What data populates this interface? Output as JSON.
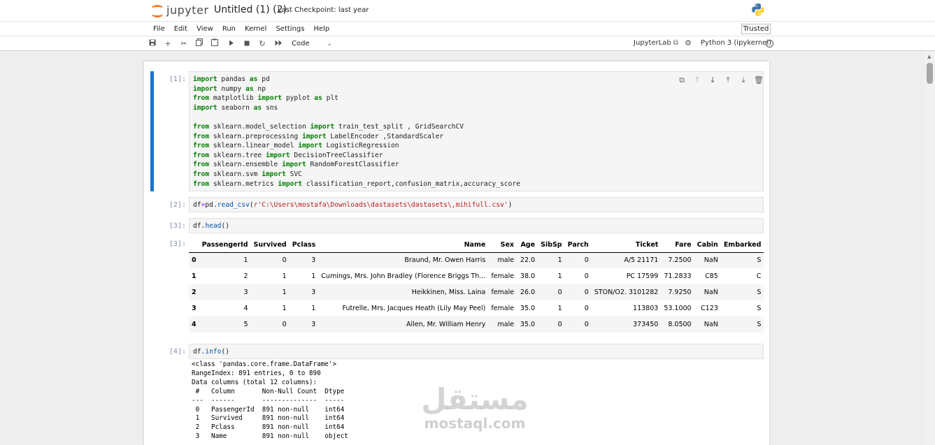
{
  "header": {
    "logo_text": "jupyter",
    "notebook_name": "Untitled (1) (2)",
    "checkpoint": "Last Checkpoint: last year"
  },
  "menu": [
    "File",
    "Edit",
    "View",
    "Run",
    "Kernel",
    "Settings",
    "Help"
  ],
  "trusted_label": "Trusted",
  "toolbar": {
    "cell_type": "Code",
    "jupyterlab_label": "JupyterLab",
    "kernel_name": "Python 3 (ipykernel)"
  },
  "cells": {
    "c1": {
      "prompt": "[1]:",
      "lines": [
        [
          [
            "kw",
            "import"
          ],
          [
            "t",
            " pandas "
          ],
          [
            "kw",
            "as"
          ],
          [
            "t",
            " pd"
          ]
        ],
        [
          [
            "kw",
            "import"
          ],
          [
            "t",
            " numpy "
          ],
          [
            "kw",
            "as"
          ],
          [
            "t",
            " np"
          ]
        ],
        [
          [
            "kw",
            "from"
          ],
          [
            "t",
            " matplotlib "
          ],
          [
            "kw",
            "import"
          ],
          [
            "t",
            " pyplot "
          ],
          [
            "kw",
            "as"
          ],
          [
            "t",
            " plt"
          ]
        ],
        [
          [
            "kw",
            "import"
          ],
          [
            "t",
            " seaborn "
          ],
          [
            "kw",
            "as"
          ],
          [
            "t",
            " sns"
          ]
        ],
        [
          [
            "t",
            ""
          ]
        ],
        [
          [
            "kw",
            "from"
          ],
          [
            "t",
            " sklearn.model_selection "
          ],
          [
            "kw",
            "import"
          ],
          [
            "t",
            " train_test_split , GridSearchCV"
          ]
        ],
        [
          [
            "kw",
            "from"
          ],
          [
            "t",
            " sklearn.preprocessing "
          ],
          [
            "kw",
            "import"
          ],
          [
            "t",
            " LabelEncoder ,StandardScaler"
          ]
        ],
        [
          [
            "kw",
            "from"
          ],
          [
            "t",
            " sklearn.linear_model "
          ],
          [
            "kw",
            "import"
          ],
          [
            "t",
            " LogisticRegression"
          ]
        ],
        [
          [
            "kw",
            "from"
          ],
          [
            "t",
            " sklearn.tree "
          ],
          [
            "kw",
            "import"
          ],
          [
            "t",
            " DecisionTreeClassifier"
          ]
        ],
        [
          [
            "kw",
            "from"
          ],
          [
            "t",
            " sklearn.ensemble "
          ],
          [
            "kw",
            "import"
          ],
          [
            "t",
            " RandomForestClassifier"
          ]
        ],
        [
          [
            "kw",
            "from"
          ],
          [
            "t",
            " sklearn.svm "
          ],
          [
            "kw",
            "import"
          ],
          [
            "t",
            " SVC"
          ]
        ],
        [
          [
            "kw",
            "from"
          ],
          [
            "t",
            " sklearn.metrics "
          ],
          [
            "kw",
            "import"
          ],
          [
            "t",
            " classification_report,confusion_matrix,accuracy_score"
          ]
        ]
      ]
    },
    "c2": {
      "prompt": "[2]:",
      "lines": [
        [
          [
            "t",
            "df"
          ],
          [
            "op",
            "="
          ],
          [
            "t",
            "pd."
          ],
          [
            "fn",
            "read_csv"
          ],
          [
            "t",
            "("
          ],
          [
            "str",
            "r'C:\\Users\\mostafa\\Downloads\\dastasets\\dastasets\\,mihifull.csv'"
          ],
          [
            "t",
            ")"
          ]
        ]
      ]
    },
    "c3": {
      "prompt": "[3]:",
      "out_prompt": "[3]:",
      "lines": [
        [
          [
            "t",
            "df."
          ],
          [
            "fn",
            "head"
          ],
          [
            "t",
            "()"
          ]
        ]
      ]
    },
    "c4": {
      "prompt": "[4]:",
      "lines": [
        [
          [
            "t",
            "df."
          ],
          [
            "fn",
            "info"
          ],
          [
            "t",
            "()"
          ]
        ]
      ]
    }
  },
  "dataframe": {
    "columns": [
      "",
      "PassengerId",
      "Survived",
      "Pclass",
      "Name",
      "Sex",
      "Age",
      "SibSp",
      "Parch",
      "Ticket",
      "Fare",
      "Cabin",
      "Embarked"
    ],
    "rows": [
      [
        "0",
        "1",
        "0",
        "3",
        "Braund, Mr. Owen Harris",
        "male",
        "22.0",
        "1",
        "0",
        "A/5 21171",
        "7.2500",
        "NaN",
        "S"
      ],
      [
        "1",
        "2",
        "1",
        "1",
        "Cumings, Mrs. John Bradley (Florence Briggs Th...",
        "female",
        "38.0",
        "1",
        "0",
        "PC 17599",
        "71.2833",
        "C85",
        "C"
      ],
      [
        "2",
        "3",
        "1",
        "3",
        "Heikkinen, Miss. Laina",
        "female",
        "26.0",
        "0",
        "0",
        "STON/O2. 3101282",
        "7.9250",
        "NaN",
        "S"
      ],
      [
        "3",
        "4",
        "1",
        "1",
        "Futrelle, Mrs. Jacques Heath (Lily May Peel)",
        "female",
        "35.0",
        "1",
        "0",
        "113803",
        "53.1000",
        "C123",
        "S"
      ],
      [
        "4",
        "5",
        "0",
        "3",
        "Allen, Mr. William Henry",
        "male",
        "35.0",
        "0",
        "0",
        "373450",
        "8.0500",
        "NaN",
        "S"
      ]
    ]
  },
  "info_output": [
    "<class 'pandas.core.frame.DataFrame'>",
    "RangeIndex: 891 entries, 0 to 890",
    "Data columns (total 12 columns):",
    " #   Column       Non-Null Count  Dtype  ",
    "---  ------       --------------  -----  ",
    " 0   PassengerId  891 non-null    int64  ",
    " 1   Survived     891 non-null    int64  ",
    " 2   Pclass       891 non-null    int64  ",
    " 3   Name         891 non-null    object "
  ],
  "watermark": {
    "arabic": "مستقل",
    "latin": "mostaql.com"
  },
  "colors": {
    "accent": "#1976d2",
    "keyword": "#008000",
    "string": "#ba2121",
    "jupyter_orange": "#f37726"
  }
}
